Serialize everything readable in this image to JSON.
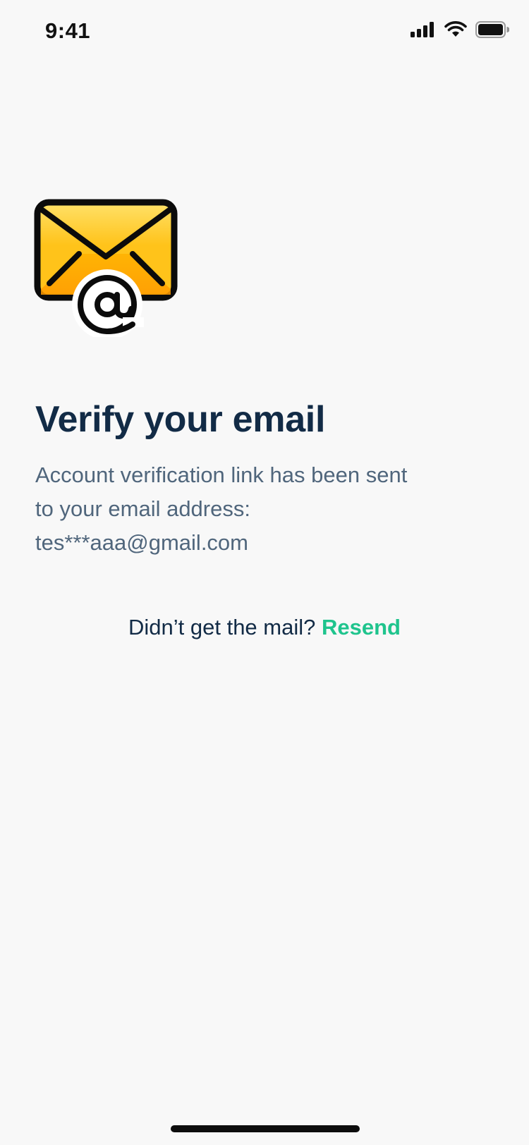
{
  "status_bar": {
    "time": "9:41",
    "icons": [
      "cellular-signal-icon",
      "wifi-icon",
      "battery-icon"
    ]
  },
  "hero_icon": "envelope-at-icon",
  "verify": {
    "title": "Verify your email",
    "description_line1": "Account verification link has been sent",
    "description_line2": "to your email address:",
    "email": "tes***aaa@gmail.com"
  },
  "resend": {
    "prompt": "Didn’t get the mail?",
    "link_label": "Resend"
  },
  "colors": {
    "background": "#F8F8F8",
    "title": "#122B46",
    "body_text": "#50667C",
    "accent": "#1FC48D",
    "envelope_yellow": "#FFC31A",
    "envelope_orange": "#FF9F00"
  }
}
